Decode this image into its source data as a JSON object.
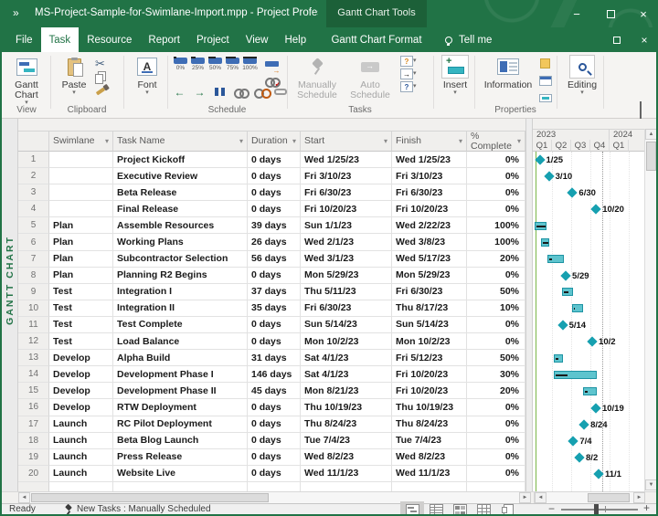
{
  "window": {
    "quick_access": "»",
    "title": "MS-Project-Sample-for-Swimlane-Import.mpp  -  Project Profes...",
    "context_tools_label": "Gantt Chart Tools",
    "controls": {
      "minimize": "−",
      "restore": "",
      "close": "×"
    }
  },
  "menu": {
    "tabs": [
      "File",
      "Task",
      "Resource",
      "Report",
      "Project",
      "View",
      "Help"
    ],
    "selected": "Task",
    "context_tab": "Gantt Chart Format",
    "tell_me": "Tell me"
  },
  "ribbon": {
    "gantt_chart_button": "Gantt Chart",
    "paste": "Paste",
    "font": "Font",
    "percent_buttons": [
      "0%",
      "25%",
      "50%",
      "75%",
      "100%"
    ],
    "manually_schedule": "Manually Schedule",
    "auto_schedule": "Auto Schedule",
    "insert": "Insert",
    "information": "Information",
    "editing": "Editing",
    "group_labels": {
      "view": "View",
      "clipboard": "Clipboard",
      "schedule": "Schedule",
      "tasks": "Tasks",
      "properties": "Properties"
    }
  },
  "view_label": "GANTT CHART",
  "table": {
    "columns": [
      "Swimlane",
      "Task Name",
      "Duration",
      "Start",
      "Finish",
      "% Complete"
    ],
    "rows": [
      {
        "id": "1",
        "swimlane": "",
        "task": "Project Kickoff",
        "duration": "0 days",
        "start": "Wed 1/25/23",
        "finish": "Wed 1/25/23",
        "pct": "0%"
      },
      {
        "id": "2",
        "swimlane": "",
        "task": "Executive Review",
        "duration": "0 days",
        "start": "Fri 3/10/23",
        "finish": "Fri 3/10/23",
        "pct": "0%"
      },
      {
        "id": "3",
        "swimlane": "",
        "task": "Beta Release",
        "duration": "0 days",
        "start": "Fri 6/30/23",
        "finish": "Fri 6/30/23",
        "pct": "0%"
      },
      {
        "id": "4",
        "swimlane": "",
        "task": "Final Release",
        "duration": "0 days",
        "start": "Fri 10/20/23",
        "finish": "Fri 10/20/23",
        "pct": "0%"
      },
      {
        "id": "5",
        "swimlane": "Plan",
        "task": "Assemble Resources",
        "duration": "39 days",
        "start": "Sun 1/1/23",
        "finish": "Wed 2/22/23",
        "pct": "100%"
      },
      {
        "id": "6",
        "swimlane": "Plan",
        "task": "Working Plans",
        "duration": "26 days",
        "start": "Wed 2/1/23",
        "finish": "Wed 3/8/23",
        "pct": "100%"
      },
      {
        "id": "7",
        "swimlane": "Plan",
        "task": "Subcontractor Selection",
        "duration": "56 days",
        "start": "Wed 3/1/23",
        "finish": "Wed 5/17/23",
        "pct": "20%"
      },
      {
        "id": "8",
        "swimlane": "Plan",
        "task": "Planning R2 Begins",
        "duration": "0 days",
        "start": "Mon 5/29/23",
        "finish": "Mon 5/29/23",
        "pct": "0%"
      },
      {
        "id": "9",
        "swimlane": "Test",
        "task": "Integration I",
        "duration": "37 days",
        "start": "Thu 5/11/23",
        "finish": "Fri 6/30/23",
        "pct": "50%"
      },
      {
        "id": "10",
        "swimlane": "Test",
        "task": "Integration II",
        "duration": "35 days",
        "start": "Fri 6/30/23",
        "finish": "Thu 8/17/23",
        "pct": "10%"
      },
      {
        "id": "11",
        "swimlane": "Test",
        "task": "Test Complete",
        "duration": "0 days",
        "start": "Sun 5/14/23",
        "finish": "Sun 5/14/23",
        "pct": "0%"
      },
      {
        "id": "12",
        "swimlane": "Test",
        "task": "Load Balance",
        "duration": "0 days",
        "start": "Mon 10/2/23",
        "finish": "Mon 10/2/23",
        "pct": "0%"
      },
      {
        "id": "13",
        "swimlane": "Develop",
        "task": "Alpha Build",
        "duration": "31 days",
        "start": "Sat 4/1/23",
        "finish": "Fri 5/12/23",
        "pct": "50%"
      },
      {
        "id": "14",
        "swimlane": "Develop",
        "task": "Development Phase I",
        "duration": "146 days",
        "start": "Sat 4/1/23",
        "finish": "Fri 10/20/23",
        "pct": "30%"
      },
      {
        "id": "15",
        "swimlane": "Develop",
        "task": "Development Phase II",
        "duration": "45 days",
        "start": "Mon 8/21/23",
        "finish": "Fri 10/20/23",
        "pct": "20%"
      },
      {
        "id": "16",
        "swimlane": "Develop",
        "task": "RTW Deployment",
        "duration": "0 days",
        "start": "Thu 10/19/23",
        "finish": "Thu 10/19/23",
        "pct": "0%"
      },
      {
        "id": "17",
        "swimlane": "Launch",
        "task": "RC Pilot Deployment",
        "duration": "0 days",
        "start": "Thu 8/24/23",
        "finish": "Thu 8/24/23",
        "pct": "0%"
      },
      {
        "id": "18",
        "swimlane": "Launch",
        "task": "Beta Blog Launch",
        "duration": "0 days",
        "start": "Tue 7/4/23",
        "finish": "Tue 7/4/23",
        "pct": "0%"
      },
      {
        "id": "19",
        "swimlane": "Launch",
        "task": "Press Release",
        "duration": "0 days",
        "start": "Wed 8/2/23",
        "finish": "Wed 8/2/23",
        "pct": "0%"
      },
      {
        "id": "20",
        "swimlane": "Launch",
        "task": "Website Live",
        "duration": "0 days",
        "start": "Wed 11/1/23",
        "finish": "Wed 11/1/23",
        "pct": "0%"
      }
    ]
  },
  "chart_data": {
    "type": "gantt",
    "timeline": {
      "years": [
        {
          "label": "2023",
          "quarters": [
            "Q1",
            "Q2",
            "Q3",
            "Q4"
          ]
        },
        {
          "label": "2024",
          "quarters": [
            "Q1"
          ]
        }
      ]
    },
    "bar_color": "#5ec4ce",
    "bar_border": "#1d93a3",
    "milestone_color": "#16a0b0",
    "items": [
      {
        "row": 1,
        "milestone": true,
        "date": "1/25",
        "label": "1/25"
      },
      {
        "row": 2,
        "milestone": true,
        "date": "3/10",
        "label": "3/10"
      },
      {
        "row": 3,
        "milestone": true,
        "date": "6/30",
        "label": "6/30"
      },
      {
        "row": 4,
        "milestone": true,
        "date": "10/20",
        "label": "10/20"
      },
      {
        "row": 5,
        "start": "1/1",
        "finish": "2/22",
        "pct": 100
      },
      {
        "row": 6,
        "start": "2/1",
        "finish": "3/8",
        "pct": 100
      },
      {
        "row": 7,
        "start": "3/1",
        "finish": "5/17",
        "pct": 20
      },
      {
        "row": 8,
        "milestone": true,
        "date": "5/29",
        "label": "5/29"
      },
      {
        "row": 9,
        "start": "5/11",
        "finish": "6/30",
        "pct": 50
      },
      {
        "row": 10,
        "start": "6/30",
        "finish": "8/17",
        "pct": 10
      },
      {
        "row": 11,
        "milestone": true,
        "date": "5/14",
        "label": "5/14"
      },
      {
        "row": 12,
        "milestone": true,
        "date": "10/2",
        "label": "10/2"
      },
      {
        "row": 13,
        "start": "4/1",
        "finish": "5/12",
        "pct": 50
      },
      {
        "row": 14,
        "start": "4/1",
        "finish": "10/20",
        "pct": 30
      },
      {
        "row": 15,
        "start": "8/21",
        "finish": "10/20",
        "pct": 20
      },
      {
        "row": 16,
        "milestone": true,
        "date": "10/19",
        "label": "10/19"
      },
      {
        "row": 17,
        "milestone": true,
        "date": "8/24",
        "label": "8/24"
      },
      {
        "row": 18,
        "milestone": true,
        "date": "7/4",
        "label": "7/4"
      },
      {
        "row": 19,
        "milestone": true,
        "date": "8/2",
        "label": "8/2"
      },
      {
        "row": 20,
        "milestone": true,
        "date": "11/1",
        "label": "11/1"
      }
    ]
  },
  "status_bar": {
    "ready": "Ready",
    "new_tasks": "New Tasks : Manually Scheduled"
  }
}
